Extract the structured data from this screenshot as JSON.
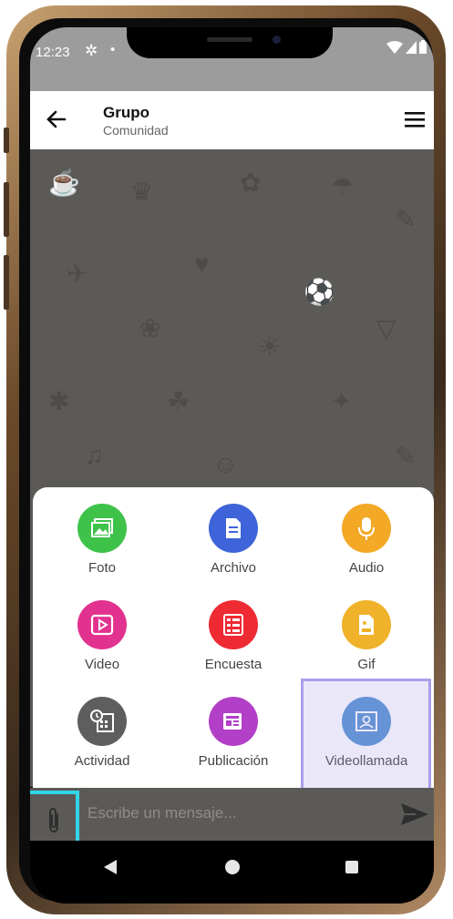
{
  "status_bar": {
    "time": "12:23",
    "settings_icon": "gear-icon",
    "dot": "•",
    "icons": [
      "wifi-icon",
      "signal-icon",
      "battery-icon"
    ]
  },
  "app_bar": {
    "title": "Grupo",
    "subtitle": "Comunidad",
    "back_icon": "back-arrow-icon",
    "menu_icon": "hamburger-menu-icon"
  },
  "attach_menu": {
    "items": [
      {
        "label": "Foto",
        "icon": "image-icon",
        "color": "#3fc24a"
      },
      {
        "label": "Archivo",
        "icon": "document-icon",
        "color": "#3f63d8"
      },
      {
        "label": "Audio",
        "icon": "microphone-icon",
        "color": "#f3a826"
      },
      {
        "label": "Video",
        "icon": "video-play-icon",
        "color": "#e2328f"
      },
      {
        "label": "Encuesta",
        "icon": "poll-list-icon",
        "color": "#ee2a33"
      },
      {
        "label": "Gif",
        "icon": "gif-file-icon",
        "color": "#f0b22a"
      },
      {
        "label": "Actividad",
        "icon": "calendar-clock-icon",
        "color": "#5e5e5e"
      },
      {
        "label": "Publicación",
        "icon": "newspaper-icon",
        "color": "#b23fc7"
      },
      {
        "label": "Videollamada",
        "icon": "video-call-portrait-icon",
        "color": "#4f8fd0"
      }
    ]
  },
  "composer": {
    "placeholder": "Escribe un mensaje...",
    "attach_icon": "paperclip-icon",
    "send_icon": "send-icon"
  },
  "nav_bar": {
    "back": "◀",
    "home": "home-circle-icon",
    "recents": "recents-square-icon"
  },
  "colors": {
    "highlight_border": "#a99fe8",
    "attach_highlight": "#32d5e8",
    "chat_bg": "#5c5a57"
  }
}
